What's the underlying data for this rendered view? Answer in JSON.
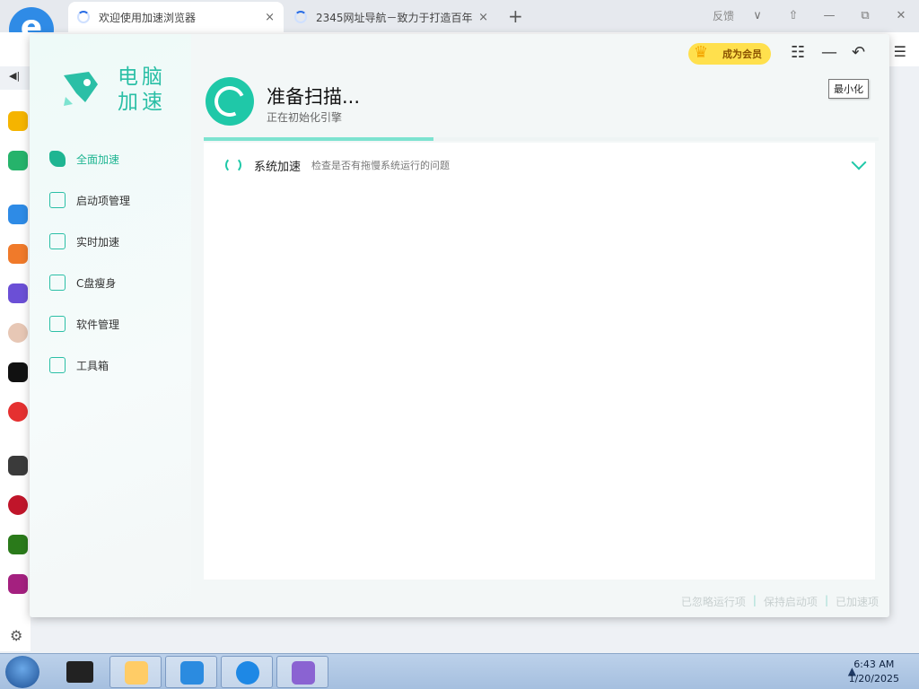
{
  "browser": {
    "tabs": [
      {
        "label": "欢迎使用加速浏览器",
        "close": "×"
      },
      {
        "label": "2345网址导航－致力于打造百年",
        "close": "×"
      }
    ],
    "new_tab": "+",
    "feedback": "反馈",
    "dropdown": "∨",
    "minimize": "—",
    "restore": "⧉",
    "close": "✕",
    "back_label": "◀|",
    "menu": "☰"
  },
  "app": {
    "brand": {
      "line1": "电脑",
      "line2": "加速"
    },
    "nav": [
      {
        "label": "全面加速",
        "active": true
      },
      {
        "label": "启动项管理"
      },
      {
        "label": "实时加速"
      },
      {
        "label": "C盘瘦身"
      },
      {
        "label": "软件管理"
      },
      {
        "label": "工具箱"
      }
    ],
    "vip_label": "成为会员",
    "list_icon": "☷",
    "minimize_icon": "—",
    "back_icon": "↶",
    "tooltip": "最小化",
    "scan": {
      "title": "准备扫描...",
      "subtitle": "正在初始化引擎",
      "progress_percent": 34
    },
    "rows": [
      {
        "title": "系统加速",
        "desc": "检查是否有拖慢系统运行的问题"
      }
    ],
    "footer": [
      "已忽略运行项",
      "保持启动项",
      "已加速项"
    ]
  },
  "taskbar": {
    "time": "6:43 AM",
    "date": "1/20/2025",
    "tray_up": "▲"
  },
  "colors": {
    "accent": "#1fc8a8",
    "vip": "#ffe04d",
    "taskbar": "#a5bfdf"
  }
}
